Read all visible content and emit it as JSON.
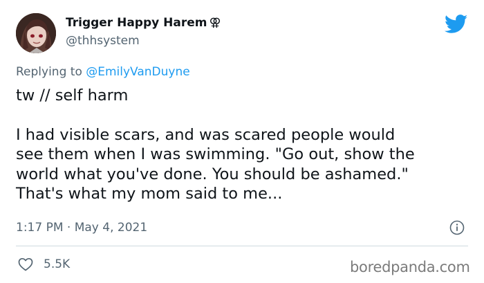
{
  "author": {
    "display_name": "Trigger Happy Harem",
    "name_symbol": "⚢",
    "handle": "@thhsystem",
    "avatar_icon": "avatar-anime-character"
  },
  "brand": {
    "logo_icon": "twitter-bird-icon",
    "logo_color": "#1d9bf0"
  },
  "reply": {
    "prefix": "Replying to",
    "mention": "@EmilyVanDuyne"
  },
  "tweet": {
    "paragraph1": "tw // self harm",
    "paragraph2": "I had visible scars, and was scared people would\nsee them when I was swimming. \"Go out, show the\nworld what you've done. You should be ashamed.\"\nThat's what my mom said to me..."
  },
  "meta": {
    "timestamp": "1:17 PM · May 4, 2021",
    "info_icon": "info-icon"
  },
  "engagement": {
    "like_icon": "heart-icon",
    "likes": "5.5K"
  },
  "watermark": "boredpanda.com",
  "colors": {
    "text_primary": "#0f1419",
    "text_secondary": "#536471",
    "accent": "#1d9bf0",
    "divider": "#cfd9de"
  }
}
